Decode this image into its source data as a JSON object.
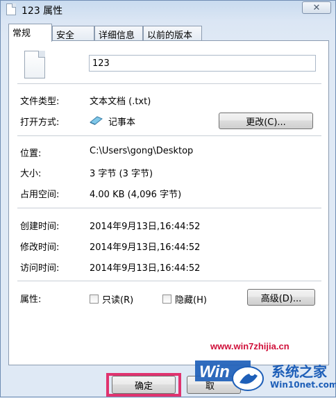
{
  "window": {
    "title": "123 属性",
    "close_glyph": "✕"
  },
  "tabs": [
    {
      "label": "常规",
      "active": true
    },
    {
      "label": "安全",
      "active": false
    },
    {
      "label": "详细信息",
      "active": false
    },
    {
      "label": "以前的版本",
      "active": false
    }
  ],
  "general": {
    "file_name": "123",
    "file_type_label": "文件类型:",
    "file_type_value": "文本文档 (.txt)",
    "open_with_label": "打开方式:",
    "open_with_value": "记事本",
    "change_button": "更改(C)...",
    "location_label": "位置:",
    "location_value": "C:\\Users\\gong\\Desktop",
    "size_label": "大小:",
    "size_value": "3 字节 (3 字节)",
    "size_on_disk_label": "占用空间:",
    "size_on_disk_value": "4.00 KB (4,096 字节)",
    "created_label": "创建时间:",
    "created_value": "2014年9月13日,16:44:52",
    "modified_label": "修改时间:",
    "modified_value": "2014年9月13日,16:44:52",
    "accessed_label": "访问时间:",
    "accessed_value": "2014年9月13日,16:44:52",
    "attributes_label": "属性:",
    "readonly_label": "只读(R)",
    "hidden_label": "隐藏(H)",
    "advanced_button": "高级(D)..."
  },
  "footer": {
    "ok_button": "确定",
    "cancel_button": "取"
  },
  "watermark": {
    "url": "www.win7zhijia.cn",
    "brand": "系统之家",
    "site": "Win10net.com"
  },
  "colors": {
    "highlight": "#e0336f",
    "watermark_red": "#d0103a",
    "watermark_blue": "#1e5fb8"
  }
}
